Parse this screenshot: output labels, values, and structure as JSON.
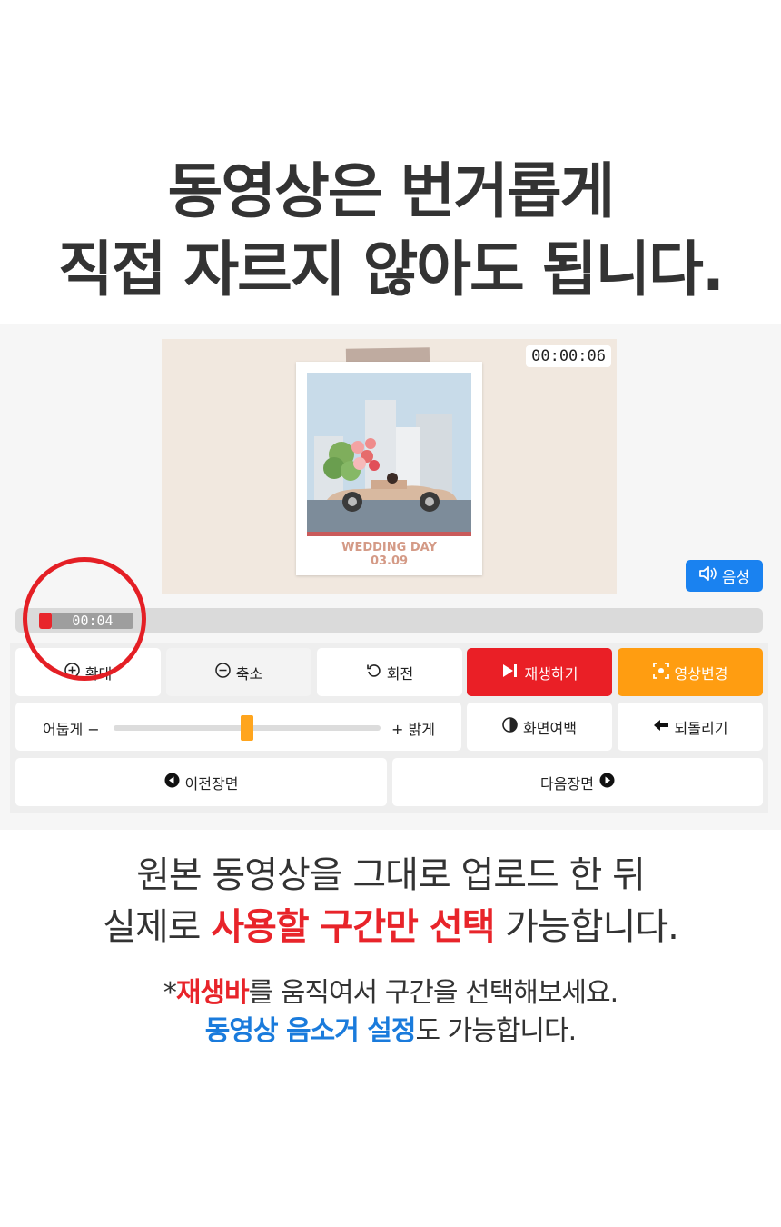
{
  "headline": {
    "line1": "동영상은 번거롭게",
    "line2": "직접 자르지 않아도 됩니다."
  },
  "player": {
    "timestamp": "00:00:06",
    "card_title": "WEDDING DAY",
    "card_date": "03.09",
    "voice_label": "음성",
    "scrub_time": "00:04"
  },
  "toolbar": {
    "zoom_in": "확대",
    "zoom_out": "축소",
    "rotate": "회전",
    "play": "재생하기",
    "change_video": "영상변경",
    "darker": "어둡게 −",
    "brighter": "+ 밝게",
    "brightness_level": 0.5,
    "screen_margin": "화면여백",
    "undo": "되돌리기",
    "prev_scene": "이전장면",
    "next_scene": "다음장면"
  },
  "body_text": {
    "line1": "원본 동영상을 그대로 업로드 한 뒤",
    "line2_pre": "실제로 ",
    "line2_highlight": "사용할 구간만 선택",
    "line2_post": " 가능합니다.",
    "line3_pre": "*",
    "line3_highlight": "재생바",
    "line3_post": "를 움직여서 구간을 선택해보세요.",
    "line4_highlight": "동영상 음소거 설정",
    "line4_post": "도 가능합니다."
  },
  "colors": {
    "accent_red": "#e8242a",
    "accent_blue": "#1a82f0",
    "accent_orange": "#ff9d11"
  }
}
